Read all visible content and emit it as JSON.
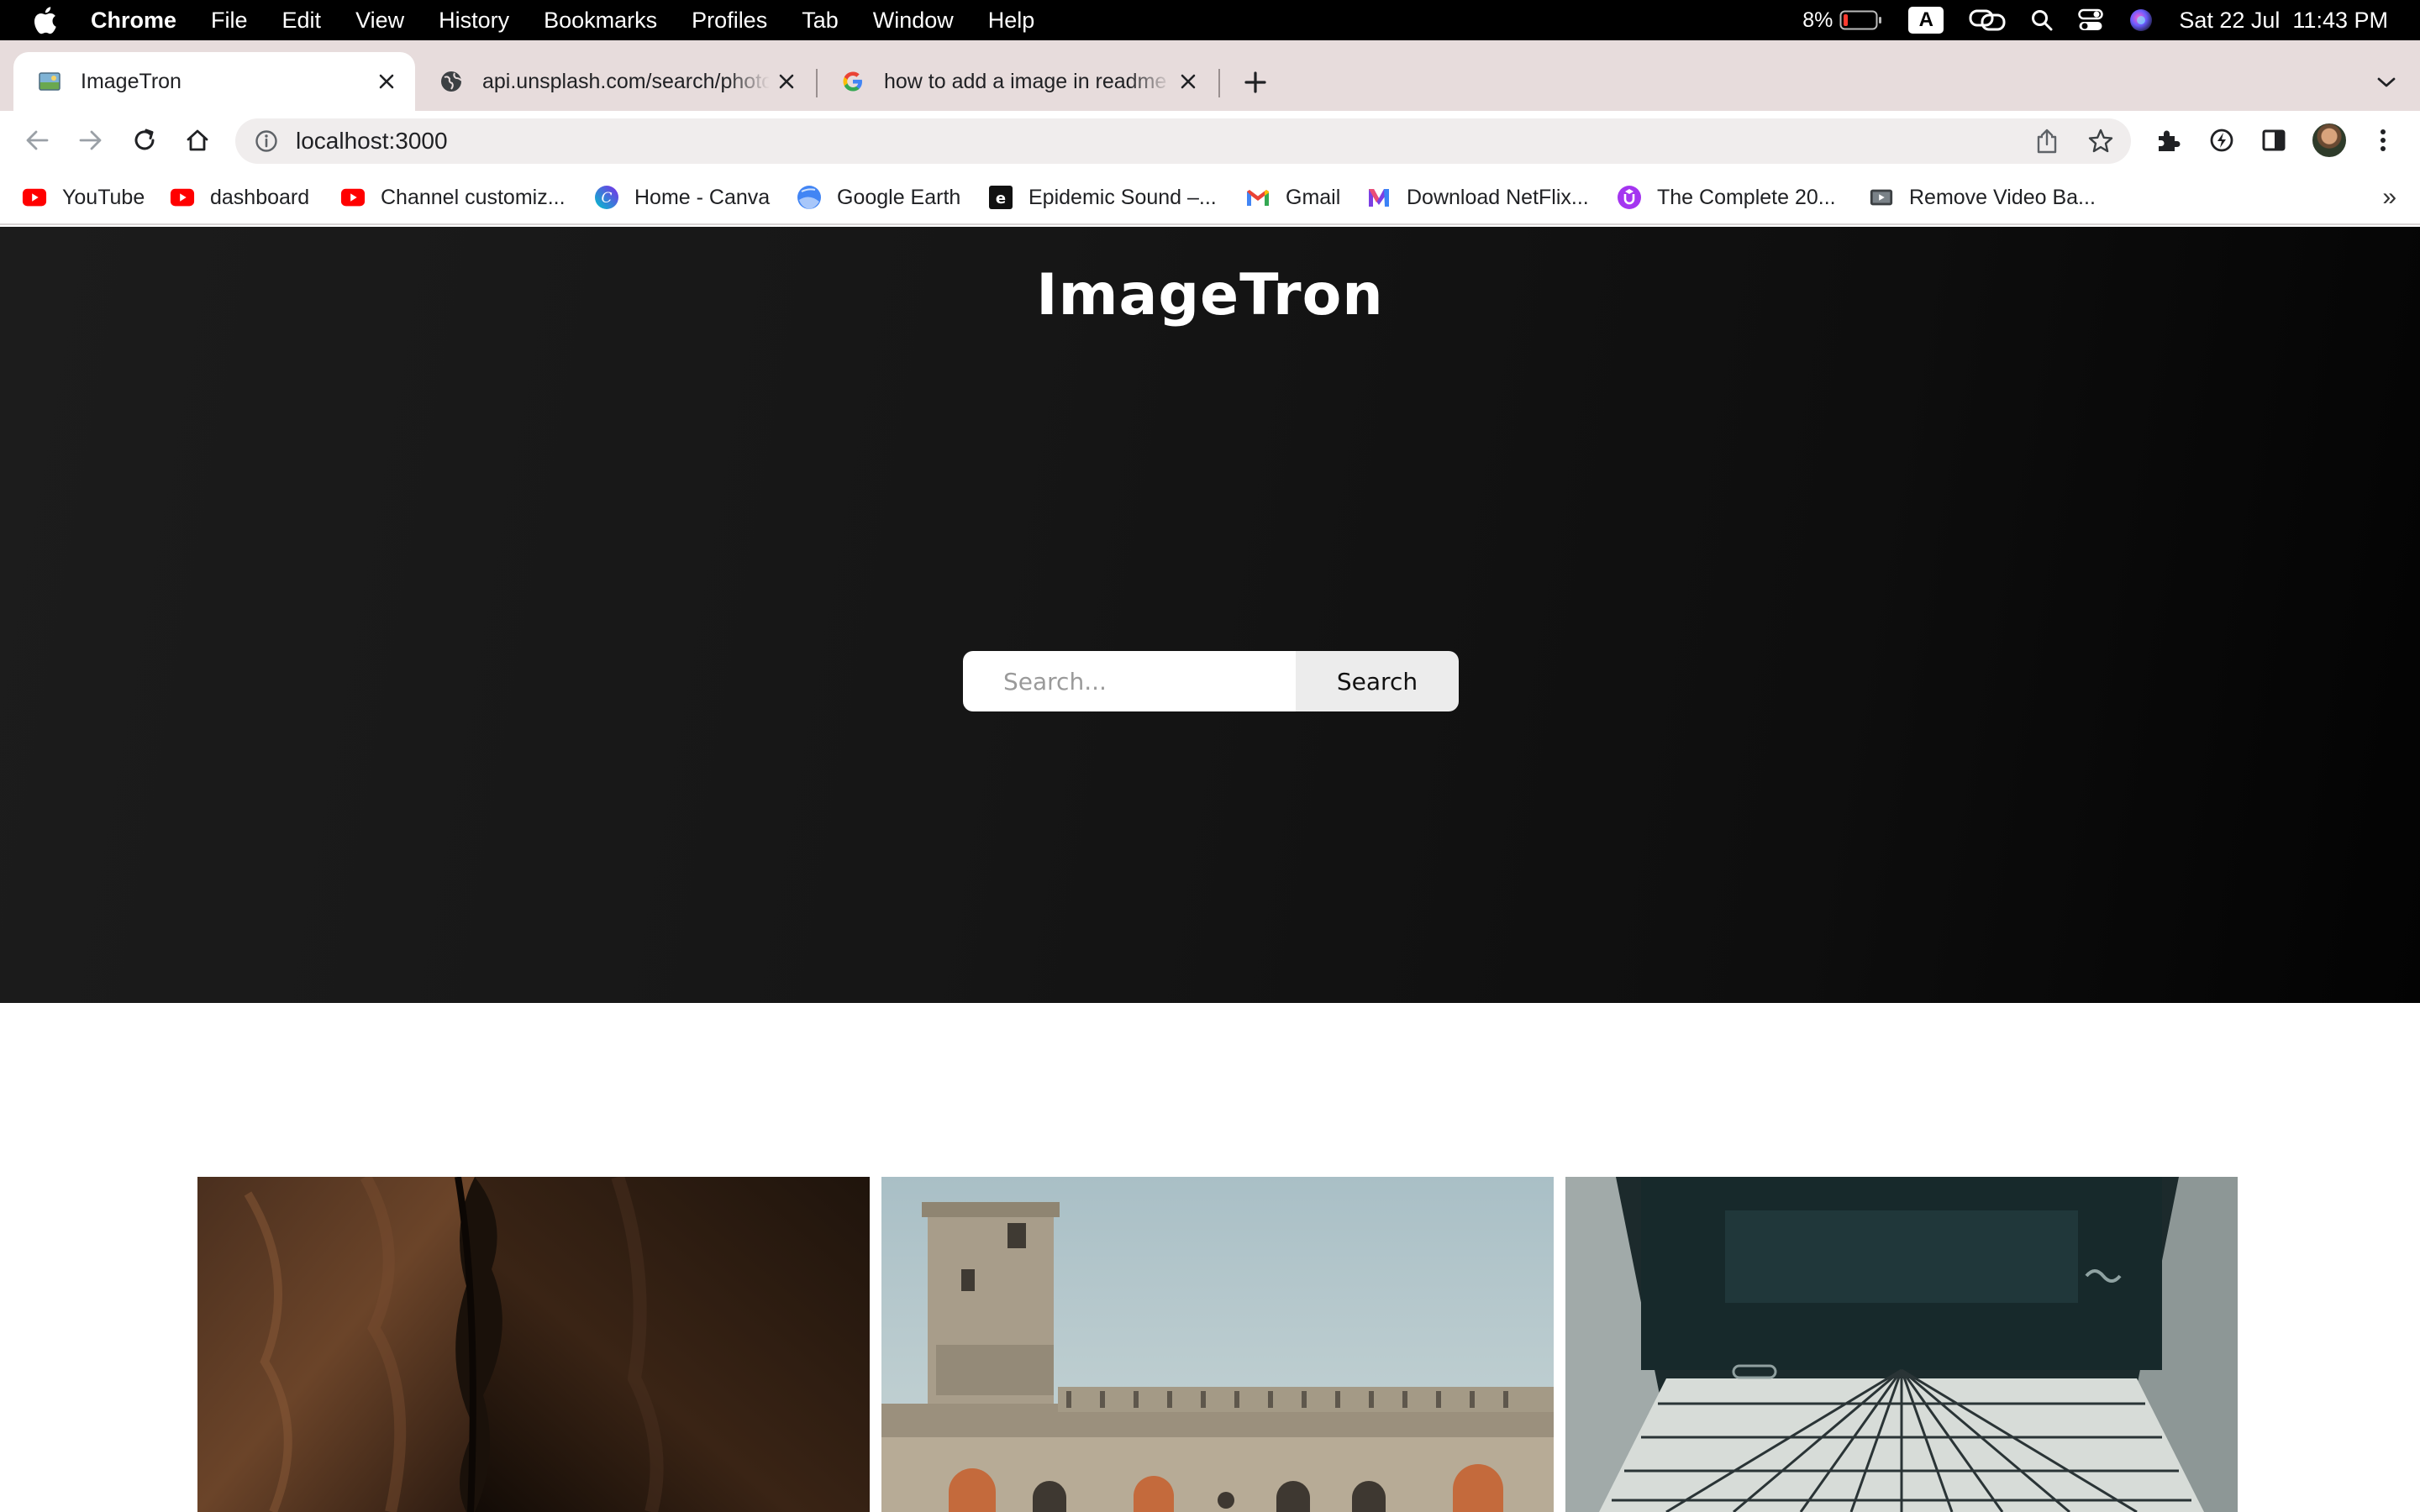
{
  "menubar": {
    "items": [
      "Chrome",
      "File",
      "Edit",
      "View",
      "History",
      "Bookmarks",
      "Profiles",
      "Tab",
      "Window",
      "Help"
    ],
    "battery": "8%",
    "input_source": "A",
    "datetime": "Sat 22 Jul  11:43 PM"
  },
  "tabs": [
    {
      "title": "ImageTron",
      "active": true
    },
    {
      "title": "api.unsplash.com/search/photos",
      "active": false
    },
    {
      "title": "how to add a image in readme f",
      "active": false
    }
  ],
  "toolbar": {
    "url": "localhost:3000"
  },
  "bookmarks": [
    {
      "label": "YouTube",
      "icon": "youtube-icon"
    },
    {
      "label": "dashboard",
      "icon": "youtube-icon"
    },
    {
      "label": "Channel customiz...",
      "icon": "youtube-icon"
    },
    {
      "label": "Home - Canva",
      "icon": "canva-icon"
    },
    {
      "label": "Google Earth",
      "icon": "google-earth-icon"
    },
    {
      "label": "Epidemic Sound –...",
      "icon": "epidemic-sound-icon"
    },
    {
      "label": "Gmail",
      "icon": "gmail-icon"
    },
    {
      "label": "Download NetFlix...",
      "icon": "m-icon"
    },
    {
      "label": "The Complete 20...",
      "icon": "udemy-icon"
    },
    {
      "label": "Remove Video Ba...",
      "icon": "video-icon"
    }
  ],
  "page": {
    "brand": "ImageTron",
    "search": {
      "placeholder": "Search...",
      "button_label": "Search"
    }
  },
  "colors": {
    "hero_bg": "#141414",
    "youtube_red": "#ff0000",
    "tab_strip": "#e7dcdc"
  }
}
